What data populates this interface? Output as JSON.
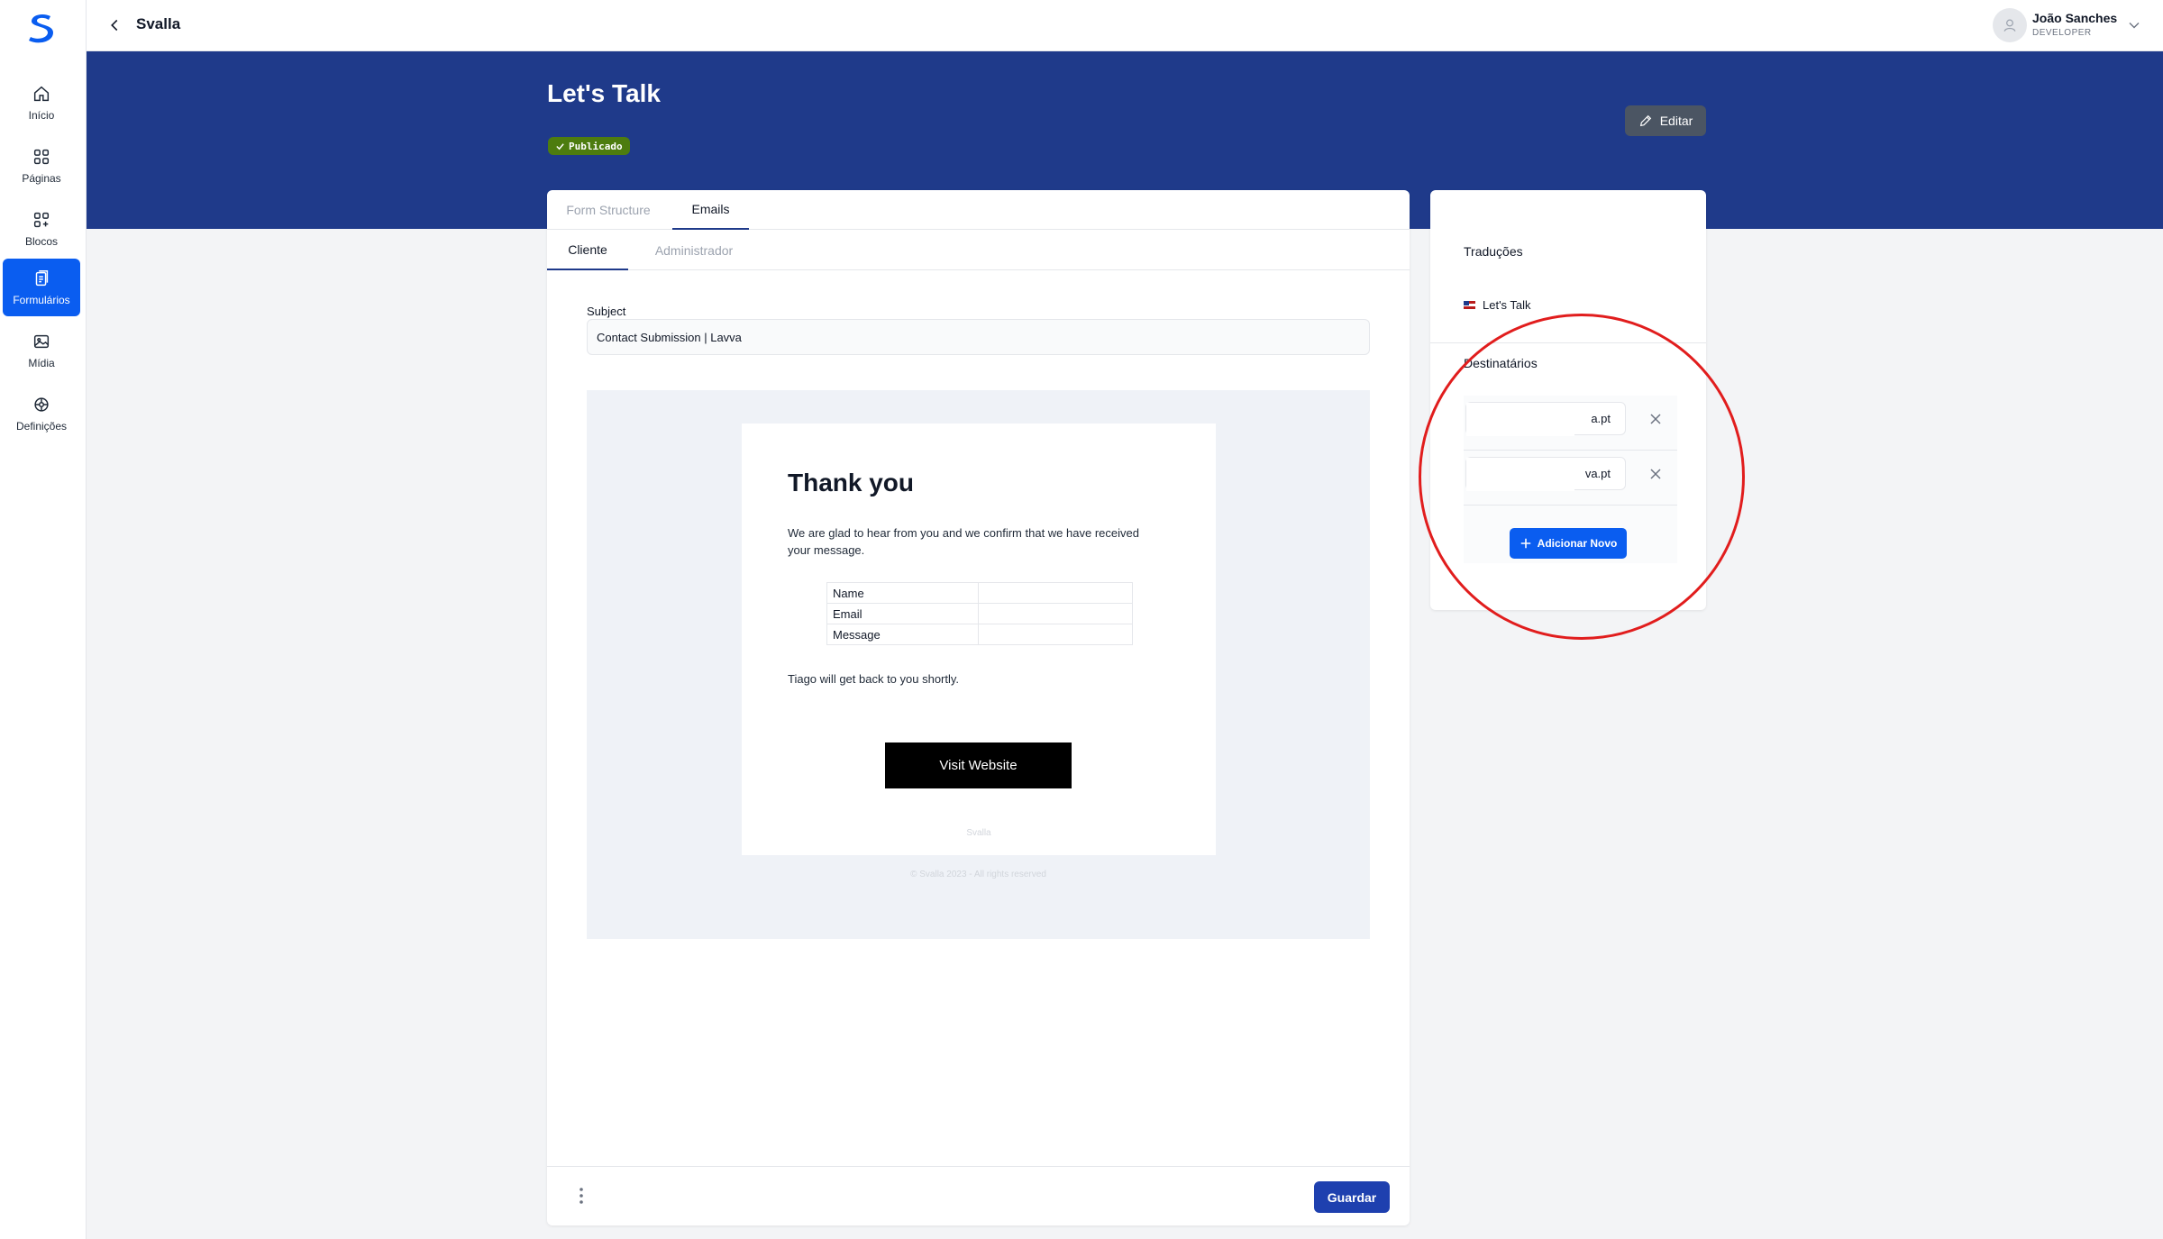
{
  "topbar": {
    "app_name": "Svalla",
    "user_name": "João Sanches",
    "user_role": "DEVELOPER"
  },
  "sidebar": {
    "items": [
      {
        "label": "Início",
        "icon": "home-icon"
      },
      {
        "label": "Páginas",
        "icon": "grid-icon"
      },
      {
        "label": "Blocos",
        "icon": "blocks-icon"
      },
      {
        "label": "Formulários",
        "icon": "forms-icon",
        "active": true
      },
      {
        "label": "Mídia",
        "icon": "image-icon"
      },
      {
        "label": "Definições",
        "icon": "settings-icon"
      }
    ]
  },
  "header": {
    "title": "Let's Talk",
    "status": "Publicado",
    "edit_label": "Editar"
  },
  "tabs": [
    {
      "label": "Form Structure"
    },
    {
      "label": "Emails",
      "active": true
    }
  ],
  "subtabs": [
    {
      "label": "Cliente",
      "active": true
    },
    {
      "label": "Administrador"
    }
  ],
  "subject": {
    "label": "Subject",
    "value": "Contact Submission | Lavva"
  },
  "email_preview": {
    "heading": "Thank you",
    "message": "We are glad to hear from you and we confirm that we have received your message.",
    "fields": [
      "Name",
      "Email",
      "Message"
    ],
    "followup": "Tiago will get back to you shortly.",
    "button": "Visit Website",
    "brand": "Svalla",
    "copyright": "© Svalla 2023 - All rights reserved"
  },
  "footer": {
    "save_label": "Guardar"
  },
  "side": {
    "translations_title": "Traduções",
    "translation_item": "Let's Talk",
    "recipients_title": "Destinatários",
    "recipients": [
      {
        "value_suffix": "a.pt"
      },
      {
        "value_suffix": "va.pt"
      }
    ],
    "add_label": "Adicionar Novo"
  },
  "colors": {
    "primary": "#1f3a8a",
    "accent": "#0a5df0",
    "published": "#4d7c0f",
    "annotation": "#e11d1d"
  }
}
